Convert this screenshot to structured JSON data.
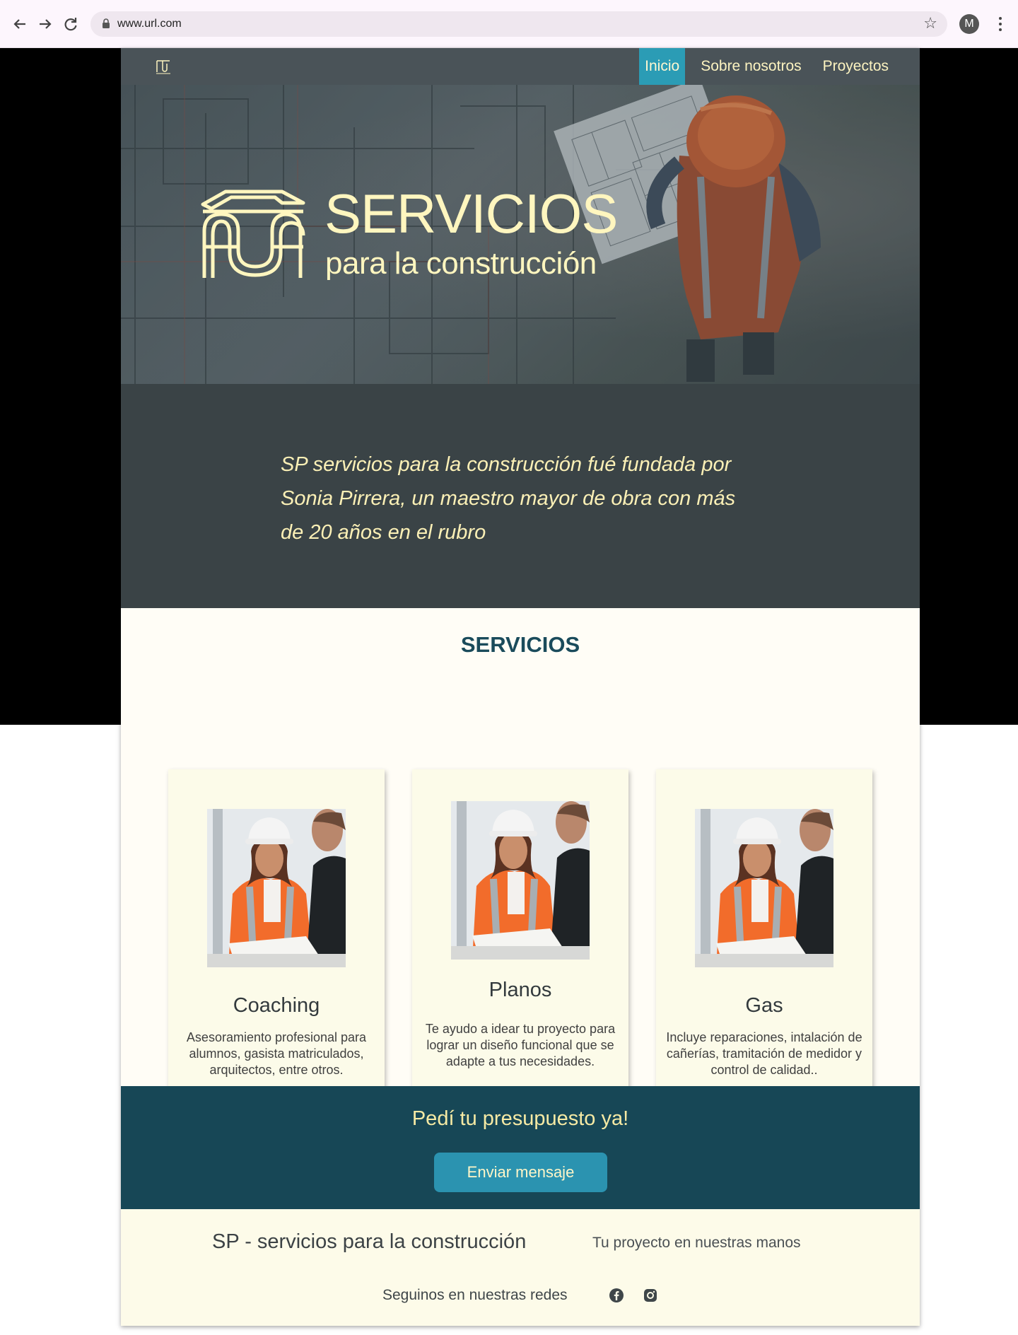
{
  "browser": {
    "url": "www.url.com",
    "profile_initial": "M",
    "back_icon": "arrow-left-icon",
    "forward_icon": "arrow-right-icon",
    "reload_icon": "reload-icon",
    "bookmark_icon": "star-icon"
  },
  "nav": {
    "items": [
      {
        "label": "Inicio",
        "active": true
      },
      {
        "label": "Sobre nosotros",
        "active": false
      },
      {
        "label": "Proyectos",
        "active": false
      }
    ]
  },
  "hero": {
    "title": "SERVICIOS",
    "subtitle": "para la construcción"
  },
  "intro": {
    "text": "SP servicios para la construcción fué fundada por Sonia Pirrera, un maestro mayor de obra con más de 20 años en el rubro"
  },
  "services": {
    "heading": "SERVICIOS",
    "cards": [
      {
        "title": "Coaching",
        "description": "Asesoramiento profesional para alumnos, gasista matriculados, arquitectos, entre otros."
      },
      {
        "title": "Planos",
        "description": "Te ayudo a idear tu proyecto para lograr un diseño funcional que se adapte a tus necesidades."
      },
      {
        "title": "Gas",
        "description": "Incluye reparaciones, intalación de cañerías, tramitación de medidor y control de calidad.."
      }
    ]
  },
  "cta": {
    "heading": "Pedí tu presupuesto ya!",
    "button_label": "Enviar mensaje"
  },
  "footer": {
    "brand": "SP - servicios para la construcción",
    "tagline": "Tu proyecto en nuestras manos",
    "follow_label": "Seguinos en nuestras redes",
    "social": [
      "facebook-icon",
      "instagram-icon"
    ]
  },
  "colors": {
    "accent": "#2b9cb5",
    "cream": "#fff6bf",
    "dark_slate": "#3a4346",
    "teal_dark": "#174756",
    "heading_teal": "#1a4b5b"
  }
}
